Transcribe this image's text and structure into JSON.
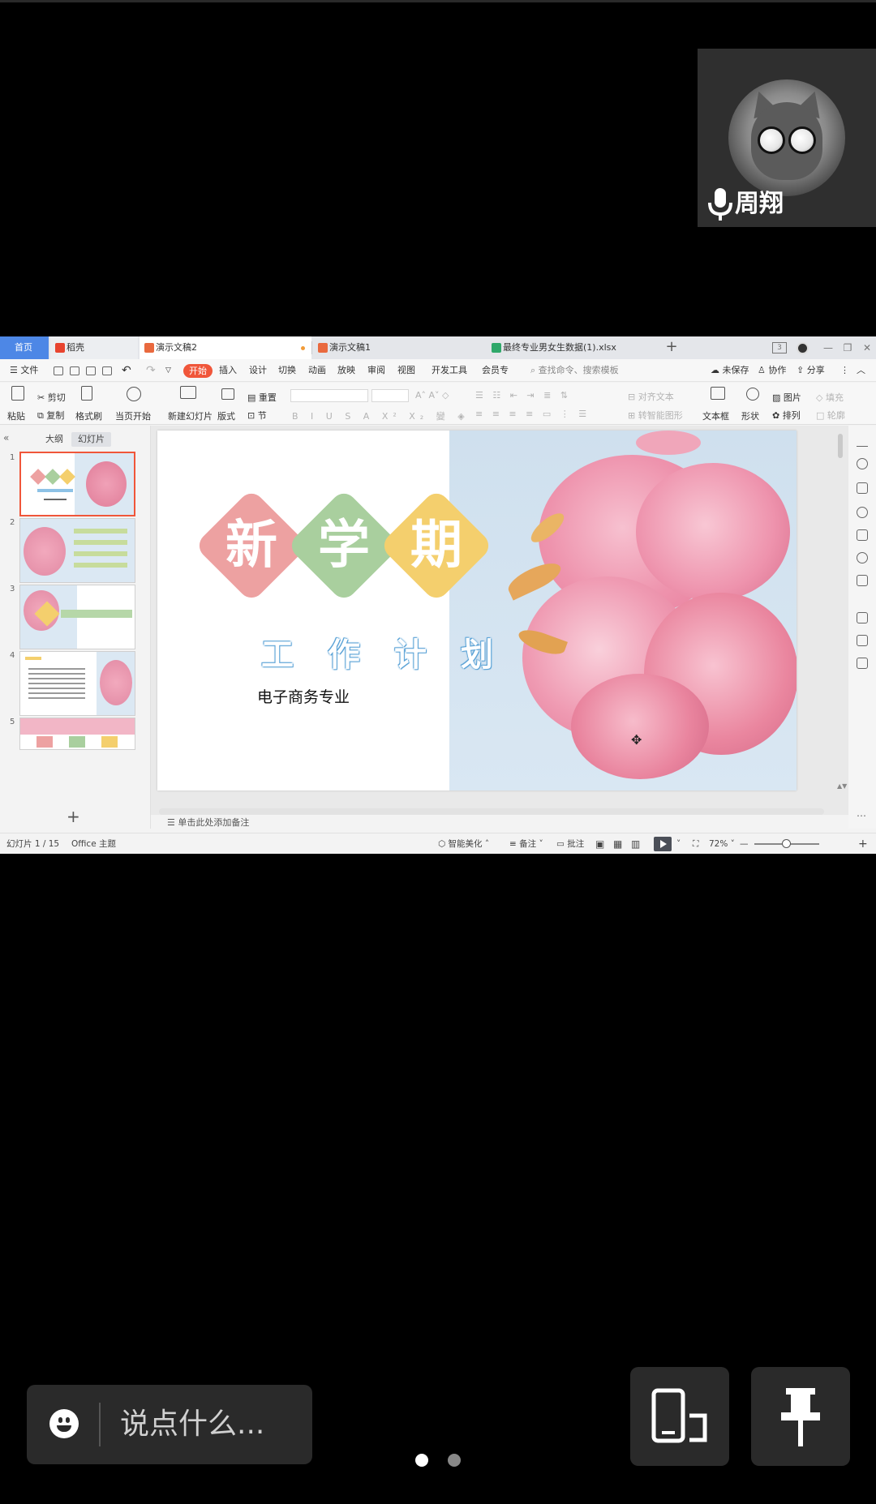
{
  "speaker": {
    "name": "周翔",
    "avatar_icon": "cat-with-glasses-avatar",
    "mic_icon": "microphone-icon"
  },
  "app": {
    "tabs": [
      {
        "label": "首页"
      },
      {
        "label": "稻壳"
      },
      {
        "label": "演示文稿2"
      },
      {
        "label": "演示文稿1"
      },
      {
        "label": "最终专业男女生数据(1).xlsx"
      }
    ],
    "title_badge": "3",
    "menus": [
      "文件",
      "开始",
      "插入",
      "设计",
      "切换",
      "动画",
      "放映",
      "审阅",
      "视图",
      "开发工具",
      "会员专"
    ],
    "search_placeholder": "查找命令、搜索模板",
    "right_actions": [
      "未保存",
      "协作",
      "分享"
    ],
    "ribbon": {
      "paste": "粘贴",
      "cut": "剪切",
      "copy": "复制",
      "format_painter": "格式刷",
      "from_current": "当页开始",
      "new_slide": "新建幻灯片",
      "layout": "版式",
      "reset": "重置",
      "section": "节",
      "align_text": "对齐文本",
      "smart_graphic": "转智能图形",
      "textbox": "文本框",
      "shape": "形状",
      "picture": "图片",
      "arrange": "排列",
      "fill": "填充",
      "outline": "轮廓"
    },
    "panel_tabs": [
      "大纲",
      "幻灯片"
    ],
    "thumb_numbers": [
      "1",
      "2",
      "3",
      "4",
      "5"
    ],
    "slide": {
      "diamond_chars": [
        "新",
        "学",
        "期"
      ],
      "subtitle": "工作计划",
      "major": "电子商务专业",
      "colors": {
        "pink": "#eda1a1",
        "green": "#a9cf9e",
        "yellow": "#f4cf6d",
        "blue_outline": "#5aa2d6"
      }
    },
    "notes_placeholder": "单击此处添加备注",
    "status": {
      "slide_counter": "幻灯片 1 / 15",
      "theme": "Office 主题",
      "beautify": "智能美化",
      "notes": "备注",
      "comment": "批注",
      "zoom": "72%"
    }
  },
  "bottom": {
    "chat_placeholder": "说点什么...",
    "emoji_icon": "smiley-icon",
    "screen_switch_icon": "phone-screen-switch-icon",
    "pin_icon": "pin-icon",
    "pages": 2,
    "current_page": 1
  }
}
